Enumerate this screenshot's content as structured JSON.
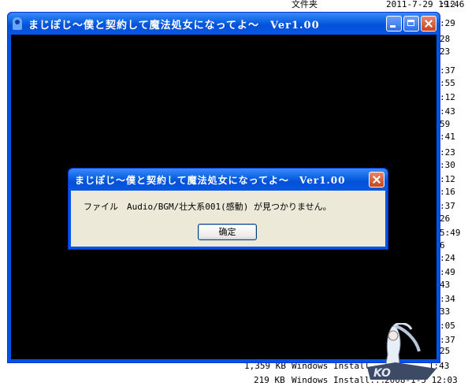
{
  "background": {
    "header_col": "文件夹",
    "header_date": "2011-7-29 19:46",
    "right_times": [
      ":12",
      ":29",
      "28",
      "23",
      ":37",
      ":55",
      ":12",
      ":43",
      "59",
      ":41",
      ":23",
      ":30",
      ":12",
      ":16",
      ":37",
      "26",
      "5:49",
      "6",
      ":24",
      ":49",
      "43",
      ":34",
      "33",
      ":05",
      ":37",
      "25"
    ],
    "rows": [
      {
        "size": "1,359 KB",
        "type": "Windows Install...",
        "date": "...1:43"
      },
      {
        "size": "219 KB",
        "type": "Windows Install...",
        "date": "2008-1-5 12:03"
      }
    ]
  },
  "main_window": {
    "title": "まじぽじ〜僕と契約して魔法処女になってよ〜　Ver1.00"
  },
  "dialog": {
    "title": "まじぽじ〜僕と契約して魔法処女になってよ〜　Ver1.00",
    "message": "ファイル　Audio/BGM/壮大系001(感動) が見つかりません。",
    "ok_label": "确定"
  },
  "watermark": {
    "brand": "KO"
  }
}
